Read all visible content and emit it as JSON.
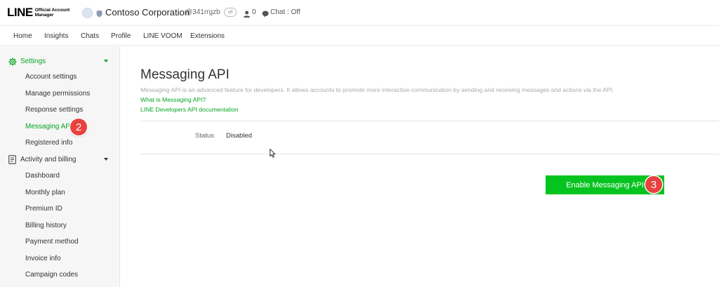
{
  "header": {
    "logo_text": "LINE",
    "logo_subtitle_1": "Official Account",
    "logo_subtitle_2": "Manager",
    "account_name": "Contoso Corporation",
    "account_id": "@341rrgzb",
    "badge": "off",
    "friends_count": "0",
    "chat_status": "Chat : Off"
  },
  "nav": {
    "items": [
      "Home",
      "Insights",
      "Chats",
      "Profile",
      "LINE VOOM",
      "Extensions"
    ]
  },
  "sidebar": {
    "settings_label": "Settings",
    "settings_items": [
      "Account settings",
      "Manage permissions",
      "Response settings",
      "Messaging API",
      "Registered info"
    ],
    "activity_label": "Activity and billing",
    "activity_items": [
      "Dashboard",
      "Monthly plan",
      "Premium ID",
      "Billing history",
      "Payment method",
      "Invoice info",
      "Campaign codes"
    ]
  },
  "main": {
    "title": "Messaging API",
    "description": "Messaging API is an advanced feature for developers. It allows accounts to promote more interactive communication by sending and receiving messages and actions via the API.",
    "link_what": "What is Messaging API?",
    "link_docs": "LINE Developers API documentation",
    "status_label": "Status",
    "status_value": "Disabled",
    "enable_button": "Enable Messaging API"
  },
  "annotations": {
    "step_2": "2",
    "step_3": "3"
  },
  "colors": {
    "accent_green": "#06a524",
    "button_green": "#06c41f",
    "step_badge_red": "#e8413f"
  }
}
